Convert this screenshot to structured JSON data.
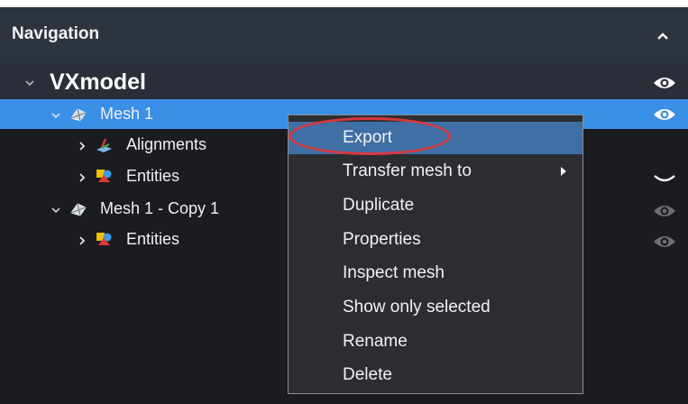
{
  "panel": {
    "title": "Navigation",
    "collapse_icon": "chevron-up-icon"
  },
  "tree": {
    "root": {
      "label": "VXmodel",
      "icon": "chevron-down-icon",
      "visibility": "eye-icon"
    },
    "items": [
      {
        "label": "Mesh 1",
        "icon": "mesh-icon",
        "expanded": true,
        "selected": true,
        "visibility": "eye-icon"
      },
      {
        "label": "Alignments",
        "icon": "alignment-icon",
        "expanded": false
      },
      {
        "label": "Entities",
        "icon": "entities-icon",
        "expanded": false,
        "visibility": "eye-closed-icon"
      },
      {
        "label": "Mesh 1 - Copy 1",
        "icon": "mesh-icon",
        "expanded": true,
        "visibility": "eye-icon"
      },
      {
        "label": "Entities",
        "icon": "entities-icon",
        "expanded": false,
        "visibility": "eye-icon"
      }
    ]
  },
  "context_menu": {
    "items": [
      {
        "label": "Export",
        "active": true
      },
      {
        "label": "Transfer mesh to",
        "submenu": true
      },
      {
        "label": "Duplicate"
      },
      {
        "label": "Properties"
      },
      {
        "label": "Inspect mesh"
      },
      {
        "label": "Show only selected"
      },
      {
        "label": "Rename"
      },
      {
        "label": "Delete"
      }
    ]
  },
  "colors": {
    "header_bg": "#2e3340",
    "selection": "#3a8fe6",
    "menu_bg": "#2b2d31",
    "menu_active": "#3f6fa5",
    "annotation": "#d9383d"
  }
}
